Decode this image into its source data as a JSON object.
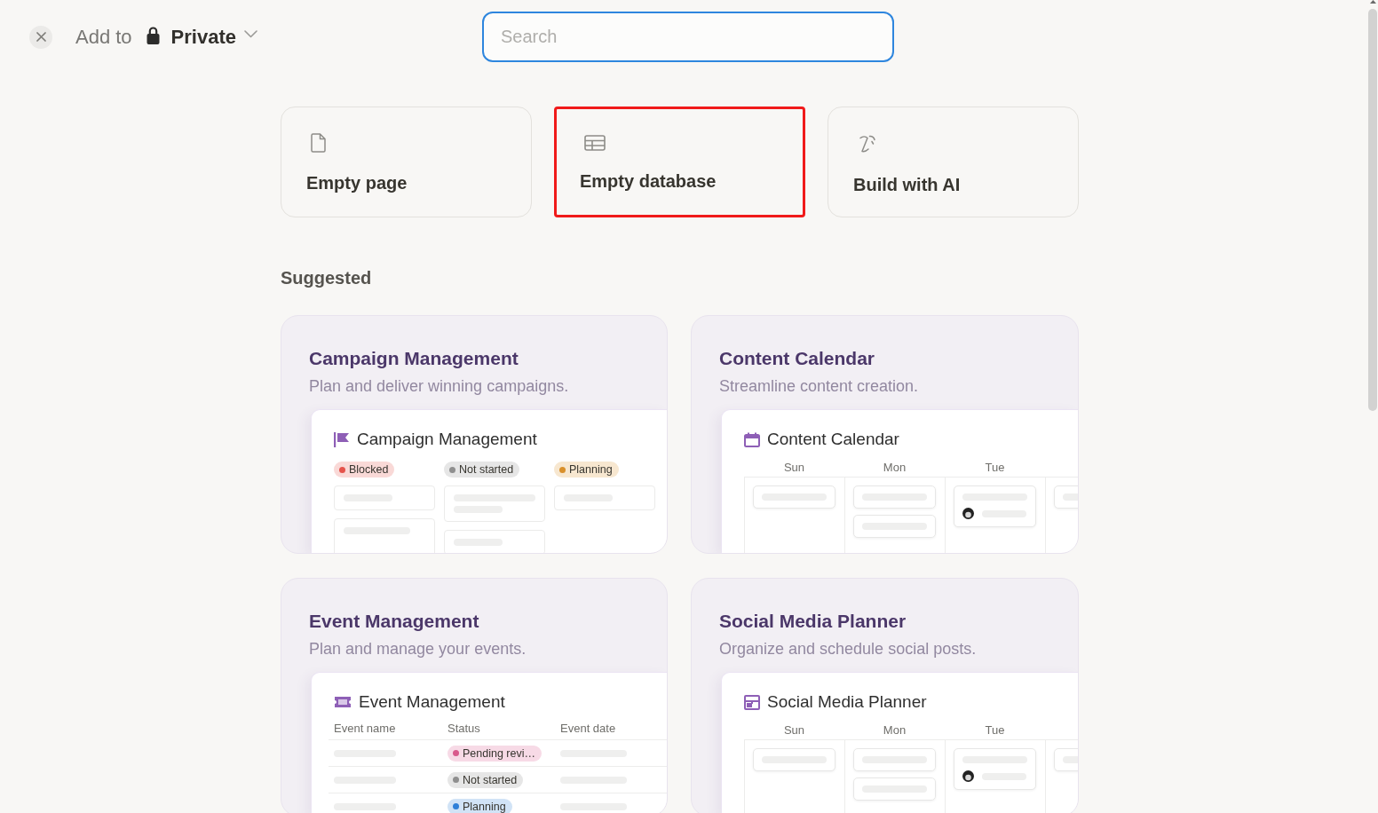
{
  "header": {
    "add_to_label": "Add to",
    "location": {
      "label": "Private"
    }
  },
  "search": {
    "placeholder": "Search",
    "focused": true
  },
  "options": [
    {
      "kind": "page",
      "label": "Empty page",
      "selected": false
    },
    {
      "kind": "database",
      "label": "Empty database",
      "selected": true
    },
    {
      "kind": "ai",
      "label": "Build with AI",
      "selected": false
    }
  ],
  "suggested": {
    "heading": "Suggested",
    "templates": [
      {
        "kind": "campaign",
        "title": "Campaign Management",
        "description": "Plan and deliver winning campaigns.",
        "preview": {
          "kind": "board",
          "title": "Campaign Management",
          "columns": [
            {
              "label": "Blocked",
              "color": "#e5534b"
            },
            {
              "label": "Not started",
              "color": "#8f8f8f"
            },
            {
              "label": "Planning",
              "color": "#d9902b"
            }
          ]
        }
      },
      {
        "kind": "calendar",
        "title": "Content Calendar",
        "description": "Streamline content creation.",
        "preview": {
          "kind": "calendar",
          "title": "Content Calendar",
          "days": [
            "Sun",
            "Mon",
            "Tue"
          ]
        }
      },
      {
        "kind": "event",
        "title": "Event Management",
        "description": "Plan and manage your events.",
        "preview": {
          "kind": "table",
          "title": "Event Management",
          "columns": [
            "Event name",
            "Status",
            "Event date"
          ],
          "rows": [
            {
              "status": "Pending revi…",
              "color": "#d9598c"
            },
            {
              "status": "Not started",
              "color": "#8f8f8f"
            },
            {
              "status": "Planning",
              "color": "#2f80d8"
            }
          ]
        }
      },
      {
        "kind": "social",
        "title": "Social Media Planner",
        "description": "Organize and schedule social posts.",
        "preview": {
          "kind": "calendar",
          "title": "Social Media Planner",
          "days": [
            "Sun",
            "Mon",
            "Tue"
          ]
        }
      }
    ]
  }
}
